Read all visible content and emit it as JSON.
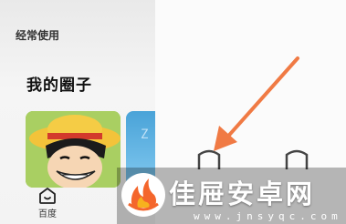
{
  "sidebar": {
    "section_label": "经常使用",
    "circles_title": "我的圈子",
    "card_2_text": "Z"
  },
  "bottom_nav": {
    "item_label": "百度",
    "item_icon": "home-icon"
  },
  "watermark": {
    "site_name": "佳屉安卓网",
    "site_url": "www.jnsyqc.com",
    "logo_icon": "flame-logo-icon"
  },
  "annotation": {
    "arrow_color": "#f07a44",
    "arrow_icon": "pointer-arrow-icon"
  },
  "colors": {
    "logo_orange": "#f4662c",
    "logo_yellow": "#f7b21e"
  }
}
